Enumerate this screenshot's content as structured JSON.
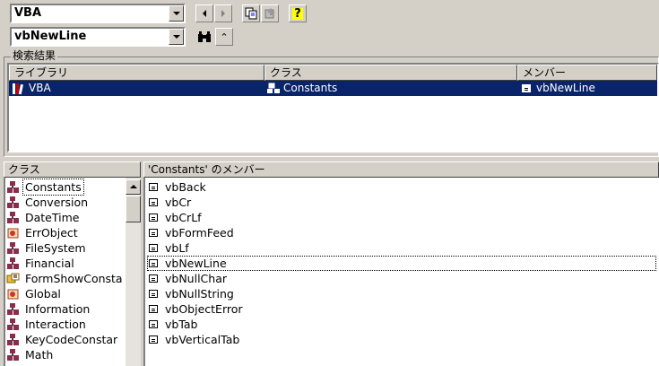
{
  "toolbar": {
    "library_value": "VBA",
    "search_value": "vbNewLine",
    "help_glyph": "?",
    "collapse_glyph": "⌃"
  },
  "search_results": {
    "group_label": "検索結果",
    "columns": [
      "ライブラリ",
      "クラス",
      "メンバー"
    ],
    "rows": [
      {
        "library": "VBA",
        "class": "Constants",
        "member": "vbNewLine"
      }
    ]
  },
  "classes_panel": {
    "header": "クラス",
    "items": [
      {
        "label": "Constants",
        "icon": "module-icon"
      },
      {
        "label": "Conversion",
        "icon": "module-icon"
      },
      {
        "label": "DateTime",
        "icon": "module-icon"
      },
      {
        "label": "ErrObject",
        "icon": "class-icon"
      },
      {
        "label": "FileSystem",
        "icon": "module-icon"
      },
      {
        "label": "Financial",
        "icon": "module-icon"
      },
      {
        "label": "FormShowConsta",
        "icon": "enum-icon"
      },
      {
        "label": "Global",
        "icon": "class-icon"
      },
      {
        "label": "Information",
        "icon": "module-icon"
      },
      {
        "label": "Interaction",
        "icon": "module-icon"
      },
      {
        "label": "KeyCodeConstar",
        "icon": "module-icon"
      },
      {
        "label": "Math",
        "icon": "module-icon"
      }
    ]
  },
  "members_panel": {
    "header": "'Constants' のメンバー",
    "items": [
      "vbBack",
      "vbCr",
      "vbCrLf",
      "vbFormFeed",
      "vbLf",
      "vbNewLine",
      "vbNullChar",
      "vbNullString",
      "vbObjectError",
      "vbTab",
      "vbVerticalTab"
    ]
  },
  "colors": {
    "face": "#d4d0c8",
    "selection": "#0a246a",
    "module_icon": "#8b2d4a"
  }
}
